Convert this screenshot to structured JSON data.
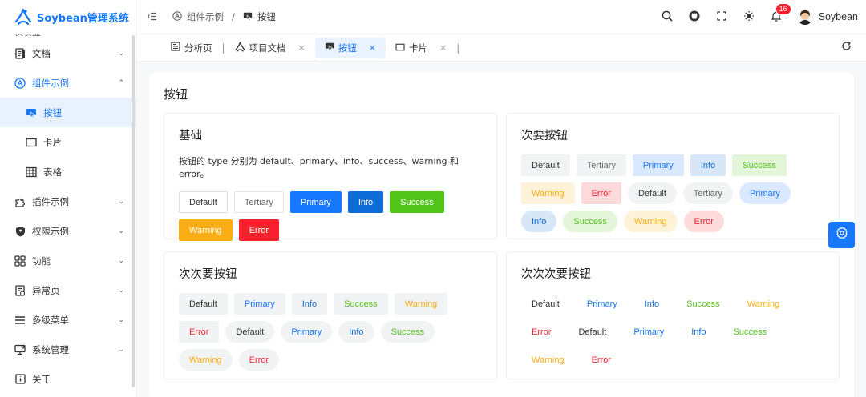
{
  "app": {
    "title": "Soybean管理系统",
    "brand_color": "#1677ff"
  },
  "header": {
    "breadcrumb": [
      {
        "label": "组件示例",
        "icon": "component-icon"
      },
      {
        "label": "按钮",
        "icon": "cursor-click-icon"
      }
    ],
    "separator": "/",
    "notification_count": "16",
    "username": "Soybean"
  },
  "sidebar": {
    "partial_label": "仪表盘",
    "items": [
      {
        "label": "文档",
        "icon": "document-icon",
        "chevron": "⌄"
      },
      {
        "label": "组件示例",
        "icon": "component-icon",
        "chevron": "⌃"
      },
      {
        "label": "按钮",
        "icon": "cursor-click-icon",
        "chevron": ""
      },
      {
        "label": "卡片",
        "icon": "card-icon",
        "chevron": ""
      },
      {
        "label": "表格",
        "icon": "table-icon",
        "chevron": ""
      },
      {
        "label": "插件示例",
        "icon": "plugin-icon",
        "chevron": "⌄"
      },
      {
        "label": "权限示例",
        "icon": "shield-icon",
        "chevron": "⌄"
      },
      {
        "label": "功能",
        "icon": "grid-icon",
        "chevron": "⌄"
      },
      {
        "label": "异常页",
        "icon": "exception-icon",
        "chevron": "⌄"
      },
      {
        "label": "多级菜单",
        "icon": "menu-icon",
        "chevron": "⌄"
      },
      {
        "label": "系统管理",
        "icon": "settings-icon",
        "chevron": "⌄"
      },
      {
        "label": "关于",
        "icon": "info-icon",
        "chevron": ""
      }
    ]
  },
  "tabs": [
    {
      "label": "分析页",
      "icon": "chart-icon",
      "closable": false
    },
    {
      "label": "项目文档",
      "icon": "logo-icon",
      "closable": true
    },
    {
      "label": "按钮",
      "icon": "cursor-click-icon",
      "closable": true,
      "active": true
    },
    {
      "label": "卡片",
      "icon": "card-icon",
      "closable": true
    }
  ],
  "tab_close": "×",
  "tab_divider": "|",
  "page": {
    "title": "按钮",
    "cards": {
      "basic": {
        "title": "基础",
        "description": "按钮的 type 分别为 default、primary、info、success、warning 和 error。",
        "buttons": [
          "Default",
          "Tertiary",
          "Primary",
          "Info",
          "Success",
          "Warning",
          "Error"
        ]
      },
      "secondary": {
        "title": "次要按钮",
        "buttons": [
          "Default",
          "Tertiary",
          "Primary",
          "Info",
          "Success",
          "Warning",
          "Error",
          "Default",
          "Tertiary",
          "Primary",
          "Info",
          "Success",
          "Warning",
          "Error"
        ]
      },
      "tertiary": {
        "title": "次次要按钮",
        "buttons": [
          "Default",
          "Primary",
          "Info",
          "Success",
          "Warning",
          "Error",
          "Default",
          "Primary",
          "Info",
          "Success",
          "Warning",
          "Error"
        ]
      },
      "quaternary": {
        "title": "次次次要按钮",
        "buttons": [
          "Default",
          "Primary",
          "Info",
          "Success",
          "Warning",
          "Error",
          "Default",
          "Primary",
          "Info",
          "Success",
          "Warning",
          "Error"
        ]
      }
    }
  },
  "colors": {
    "primary": "#1677ff",
    "info": "#0f6cd6",
    "success": "#52c41a",
    "warning": "#faad14",
    "error": "#f5222d"
  }
}
